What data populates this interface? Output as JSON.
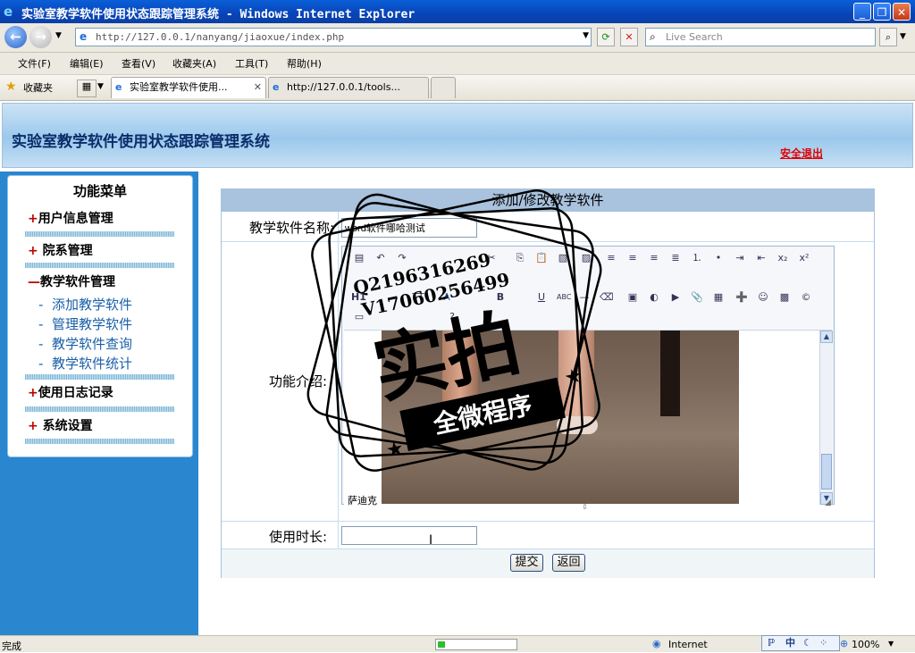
{
  "window": {
    "title": "实验室教学软件使用状态跟踪管理系统 - Windows Internet Explorer"
  },
  "nav": {
    "address": "http://127.0.0.1/nanyang/jiaoxue/index.php",
    "search_placeholder": "Live Search"
  },
  "menubar": [
    "文件(F)",
    "编辑(E)",
    "查看(V)",
    "收藏夹(A)",
    "工具(T)",
    "帮助(H)"
  ],
  "favorites": {
    "label": "收藏夹",
    "tabs": [
      "实验室教学软件使用...",
      "http://127.0.0.1/tools..."
    ]
  },
  "header": {
    "system_title": "实验室教学软件使用状态跟踪管理系统",
    "logout": "安全退出"
  },
  "sidebar": {
    "title": "功能菜单",
    "groups": [
      {
        "label": "用户信息管理",
        "marker": "+"
      },
      {
        "label": "院系管理",
        "marker": "+"
      },
      {
        "label": "教学软件管理",
        "marker": "—"
      },
      {
        "label": "使用日志记录",
        "marker": "+"
      },
      {
        "label": "系统设置",
        "marker": "+"
      }
    ],
    "subitems": [
      "添加教学软件",
      "管理教学软件",
      "教学软件查询",
      "教学软件统计"
    ],
    "sub_marker": "-"
  },
  "form": {
    "title": "添加/修改教学软件",
    "name_label": "教学软件名称:",
    "name_value": "word软件哪哈测试",
    "intro_label": "功能介绍:",
    "editor_text": "萨迪克",
    "duration_label": "使用时长:",
    "duration_value": "",
    "submit": "提交",
    "back": "返回"
  },
  "watermark": {
    "lines": [
      "Q2196316269",
      "V17060256499"
    ],
    "big": "实拍",
    "banner": "全微程序"
  },
  "status": {
    "text": "完成",
    "zone": "Internet",
    "zoom": "100%",
    "progress": 0.05
  },
  "ime": "中"
}
